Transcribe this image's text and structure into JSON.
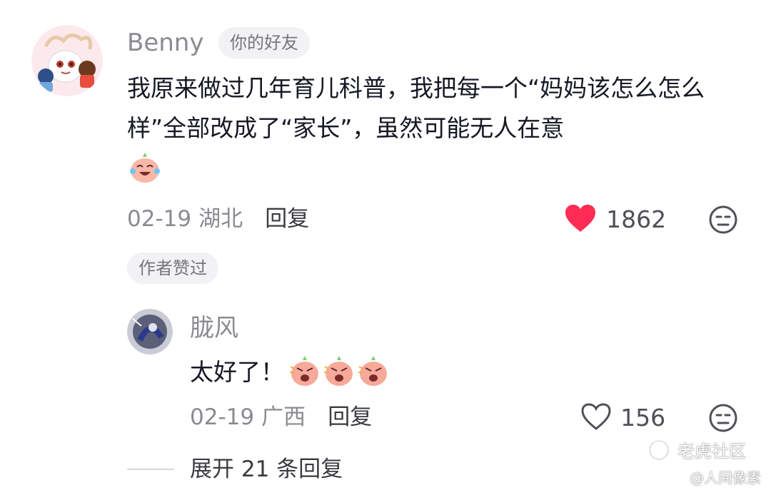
{
  "comment": {
    "author": "Benny",
    "friend_badge": "你的好友",
    "text": "我原来做过几年育儿科普，我把每一个“妈妈该怎么怎么样”全部改成了“家长”，虽然可能无人在意",
    "date": "02-19",
    "location": "湖北",
    "reply_label": "回复",
    "like_count": "1862",
    "author_liked_badge": "作者赞过",
    "colors": {
      "liked_heart": "#fe2c55",
      "name": "#8a8b91"
    }
  },
  "reply": {
    "author": "胧风",
    "text": "太好了！",
    "date": "02-19",
    "location": "广西",
    "reply_label": "回复",
    "like_count": "156"
  },
  "expand_label": "展开 21 条回复",
  "watermarks": {
    "community": "老虎社区",
    "source": "@人间像素"
  }
}
